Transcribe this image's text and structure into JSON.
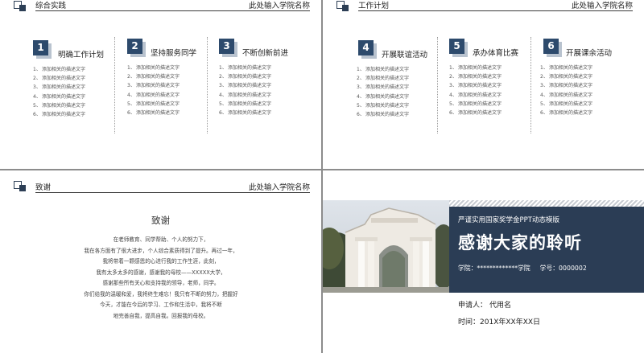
{
  "slide1": {
    "header_title": "综合实践",
    "header_right": "此处输入学院名称",
    "columns": [
      {
        "num": "1",
        "title": "明确工作计划",
        "items": [
          {
            "n": "1、",
            "t": "添加相关的描述文字"
          },
          {
            "n": "2、",
            "t": "添加相关的描述文字"
          },
          {
            "n": "3、",
            "t": "添加相关的描述文字"
          },
          {
            "n": "4、",
            "t": "添加相关的描述文字"
          },
          {
            "n": "5、",
            "t": "添加相关的描述文字"
          },
          {
            "n": "6、",
            "t": "添加相关的描述文字"
          }
        ]
      },
      {
        "num": "2",
        "title": "坚持服务同学",
        "items": [
          {
            "n": "1、",
            "t": "添加相关的描述文字"
          },
          {
            "n": "2、",
            "t": "添加相关的描述文字"
          },
          {
            "n": "3、",
            "t": "添加相关的描述文字"
          },
          {
            "n": "4、",
            "t": "添加相关的描述文字"
          },
          {
            "n": "5、",
            "t": "添加相关的描述文字"
          },
          {
            "n": "6、",
            "t": "添加相关的描述文字"
          }
        ]
      },
      {
        "num": "3",
        "title": "不断创新前进",
        "items": [
          {
            "n": "1、",
            "t": "添加相关的描述文字"
          },
          {
            "n": "2、",
            "t": "添加相关的描述文字"
          },
          {
            "n": "3、",
            "t": "添加相关的描述文字"
          },
          {
            "n": "4、",
            "t": "添加相关的描述文字"
          },
          {
            "n": "5、",
            "t": "添加相关的描述文字"
          },
          {
            "n": "6、",
            "t": "添加相关的描述文字"
          }
        ]
      }
    ]
  },
  "slide2": {
    "header_title": "工作计划",
    "header_right": "此处输入学院名称",
    "columns": [
      {
        "num": "4",
        "title": "开展联谊活动",
        "items": [
          {
            "n": "1、",
            "t": "添加相关的描述文字"
          },
          {
            "n": "2、",
            "t": "添加相关的描述文字"
          },
          {
            "n": "3、",
            "t": "添加相关的描述文字"
          },
          {
            "n": "4、",
            "t": "添加相关的描述文字"
          },
          {
            "n": "5、",
            "t": "添加相关的描述文字"
          },
          {
            "n": "6、",
            "t": "添加相关的描述文字"
          }
        ]
      },
      {
        "num": "5",
        "title": "承办体育比赛",
        "items": [
          {
            "n": "1、",
            "t": "添加相关的描述文字"
          },
          {
            "n": "2、",
            "t": "添加相关的描述文字"
          },
          {
            "n": "3、",
            "t": "添加相关的描述文字"
          },
          {
            "n": "4、",
            "t": "添加相关的描述文字"
          },
          {
            "n": "5、",
            "t": "添加相关的描述文字"
          },
          {
            "n": "6、",
            "t": "添加相关的描述文字"
          }
        ]
      },
      {
        "num": "6",
        "title": "开展课余活动",
        "items": [
          {
            "n": "1、",
            "t": "添加相关的描述文字"
          },
          {
            "n": "2、",
            "t": "添加相关的描述文字"
          },
          {
            "n": "3、",
            "t": "添加相关的描述文字"
          },
          {
            "n": "4、",
            "t": "添加相关的描述文字"
          },
          {
            "n": "5、",
            "t": "添加相关的描述文字"
          },
          {
            "n": "6、",
            "t": "添加相关的描述文字"
          }
        ]
      }
    ]
  },
  "slide3": {
    "header_title": "致谢",
    "header_right": "此处输入学院名称",
    "title": "致谢",
    "lines": [
      "在老师教育、同学帮助、个人的努力下，",
      "我在各方面有了很大进步，个人综合素质得到了提升。再过一年，",
      "我将带着一颗感恩的心进行我的工作生涯，此刻，",
      "我有太多太多的感谢，感谢我的母校——XXXXX大学，",
      "感谢那些所有关心和支持我的领导，老师，同学。",
      "你们给我的温暖和爱，我将终生难忘！我只有不断的努力，把握好",
      "今天，才能在今后的学习、工作和生活中，我将不断",
      "地完善自我，提高自我。回报我的母校。"
    ]
  },
  "slide4": {
    "subtitle": "严谨实用国家奖学金PPT动态模版",
    "main_title": "感谢大家的聆听",
    "school_label": "学院：*************学院",
    "student_id_label": "学号：0000002",
    "applicant_label": "申请人：",
    "applicant_value": "代用名",
    "time_label": "时间：",
    "time_value": "201X年XX年XX日"
  },
  "colors": {
    "accent_navy": "#2d4a6c",
    "band_navy": "#2b3d55",
    "badge_shadow": "#b9c3cf"
  },
  "icons": {
    "header_marker": "square-outline-with-filled-square-icon"
  }
}
